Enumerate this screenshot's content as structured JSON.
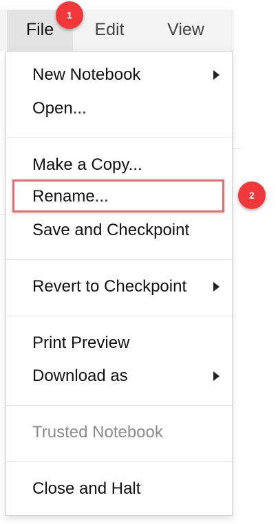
{
  "menubar": {
    "file_label": "File",
    "edit_label": "Edit",
    "view_label": "View"
  },
  "file_menu": {
    "items": [
      {
        "label": "New Notebook",
        "submenu": true,
        "enabled": true
      },
      {
        "label": "Open...",
        "submenu": false,
        "enabled": true
      },
      {
        "label": "Make a Copy...",
        "submenu": false,
        "enabled": true
      },
      {
        "label": "Rename...",
        "submenu": false,
        "enabled": true,
        "highlighted": true
      },
      {
        "label": "Save and Checkpoint",
        "submenu": false,
        "enabled": true
      },
      {
        "label": "Revert to Checkpoint",
        "submenu": true,
        "enabled": true
      },
      {
        "label": "Print Preview",
        "submenu": false,
        "enabled": true
      },
      {
        "label": "Download as",
        "submenu": true,
        "enabled": true
      },
      {
        "label": "Trusted Notebook",
        "submenu": false,
        "enabled": false
      },
      {
        "label": "Close and Halt",
        "submenu": false,
        "enabled": true
      }
    ]
  },
  "annotations": {
    "step1": "1",
    "step2": "2"
  },
  "colors": {
    "badge": "#f0383a",
    "highlight_border": "#e4716f",
    "disabled_text": "#8b8b8b",
    "menubar_bg": "#f3f3f3",
    "menubar_active_bg": "#e3e3e3"
  }
}
